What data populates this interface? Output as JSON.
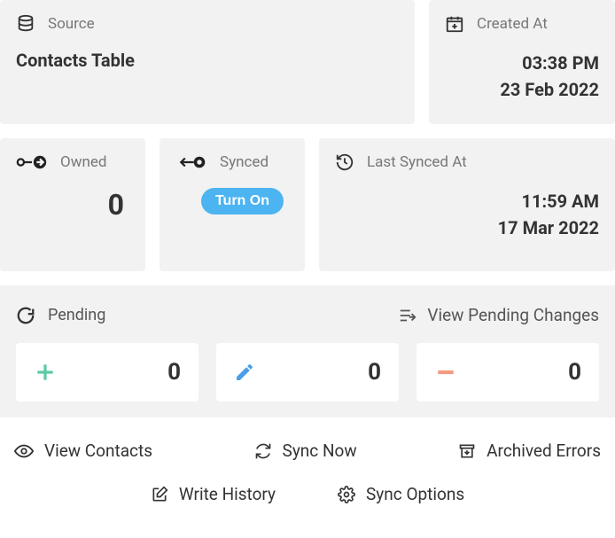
{
  "source": {
    "label": "Source",
    "value": "Contacts Table"
  },
  "created": {
    "label": "Created At",
    "time": "03:38 PM",
    "date": "23 Feb 2022"
  },
  "owned": {
    "label": "Owned",
    "value": "0"
  },
  "synced": {
    "label": "Synced",
    "button": "Turn On"
  },
  "last_synced": {
    "label": "Last Synced At",
    "time": "11:59 AM",
    "date": "17 Mar 2022"
  },
  "pending": {
    "label": "Pending",
    "view_label": "View Pending Changes",
    "add": "0",
    "edit": "0",
    "remove": "0"
  },
  "actions": {
    "view_contacts": "View Contacts",
    "sync_now": "Sync Now",
    "archived_errors": "Archived Errors",
    "write_history": "Write History",
    "sync_options": "Sync Options"
  }
}
